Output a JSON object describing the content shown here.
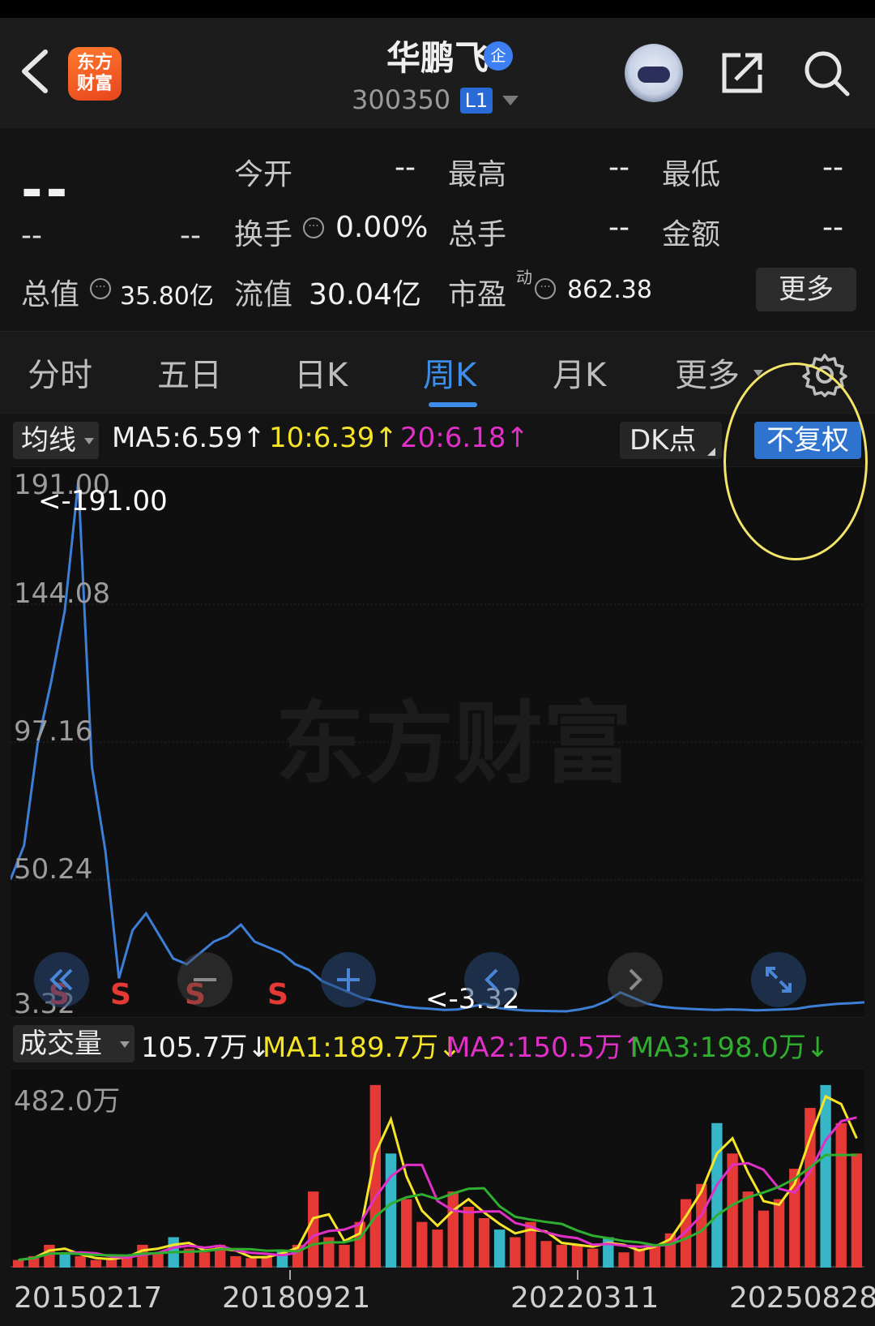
{
  "header": {
    "app_logo_text_line1": "东方",
    "app_logo_text_line2": "财富",
    "stock_name": "华鹏飞",
    "qi_badge": "企",
    "stock_code": "300350",
    "level_badge": "L1"
  },
  "quote": {
    "price": "--",
    "change": "--",
    "change_pct": "--",
    "open_label": "今开",
    "open_value": "--",
    "high_label": "最高",
    "high_value": "--",
    "low_label": "最低",
    "low_value": "--",
    "turnover_label": "换手",
    "turnover_value": "0.00%",
    "volume_label": "总手",
    "volume_value": "--",
    "amount_label": "金额",
    "amount_value": "--",
    "mktcap_label": "总值",
    "mktcap_value": "35.80亿",
    "float_label": "流值",
    "float_value": "30.04亿",
    "pe_label": "市盈",
    "pe_superscript": "动",
    "pe_value": "862.38",
    "more_button": "更多"
  },
  "tabs": [
    {
      "label": "分时",
      "active": false
    },
    {
      "label": "五日",
      "active": false
    },
    {
      "label": "日K",
      "active": false
    },
    {
      "label": "周K",
      "active": true
    },
    {
      "label": "月K",
      "active": false
    },
    {
      "label": "更多",
      "active": false
    }
  ],
  "ma_bar": {
    "indicator": "均线",
    "ma5": "MA5:6.59↑",
    "ma10": "10:6.39↑",
    "ma20": "20:6.18↑",
    "dk_button": "DK点",
    "adjust_button": "不复权"
  },
  "price_axis": {
    "max_label": "191.00",
    "tick2": "144.08",
    "tick3": "97.16",
    "tick4": "50.24",
    "min_label": "3.32",
    "max_marker": "<-191.00",
    "min_marker": "<-3.32",
    "watermark": "东方财富",
    "signal_marks": [
      "S",
      "S",
      "S",
      "S",
      "S"
    ]
  },
  "volume_bar": {
    "indicator": "成交量",
    "current": "105.7万↓",
    "ma1": "MA1:189.7万↓",
    "ma2": "MA2:150.5万↑",
    "ma3": "MA3:198.0万↓",
    "max_label": "482.0万"
  },
  "dates": [
    "20150217",
    "20180921",
    "20220311",
    "20250828"
  ],
  "colors": {
    "accent_blue": "#3d8eea",
    "price_line": "#3d7fd6",
    "up_red": "#e53935",
    "ma_yellow": "#f5e427",
    "ma_magenta": "#e030c8",
    "ma_green": "#2fae2f",
    "highlight": "#f3e56a"
  },
  "chart_data": [
    {
      "type": "line",
      "title": "",
      "xlabel": "",
      "ylabel": "",
      "ylim": [
        3.32,
        191.0
      ],
      "x_ticks": [
        "20150217",
        "20180921",
        "20220311",
        "20250828"
      ],
      "series": [
        {
          "values": [
            50,
            62,
            98,
            120,
            145,
            191,
            90,
            60,
            15,
            32,
            38,
            30,
            22,
            20,
            24,
            28,
            30,
            34,
            28,
            26,
            24,
            20,
            18,
            14,
            12,
            10,
            8,
            7,
            6,
            5,
            4.5,
            4.2,
            3.8,
            4,
            5,
            6,
            4.5,
            4,
            3.6,
            3.5,
            3.4,
            3.32,
            4,
            5,
            7,
            10,
            8,
            6,
            5,
            4.5,
            4.2,
            4,
            3.8,
            4,
            3.9,
            3.7,
            3.8,
            4,
            4.2,
            5,
            5.5,
            6,
            6.2,
            6.5
          ]
        }
      ]
    },
    {
      "type": "bar",
      "title": "",
      "ylim": [
        0,
        482.0
      ],
      "series": [
        {
          "values": [
            20,
            30,
            60,
            40,
            30,
            20,
            25,
            30,
            60,
            40,
            80,
            50,
            40,
            60,
            30,
            25,
            30,
            45,
            60,
            200,
            80,
            60,
            120,
            480,
            300,
            180,
            120,
            100,
            200,
            160,
            130,
            100,
            80,
            120,
            70,
            60,
            60,
            50,
            80,
            40,
            50,
            60,
            90,
            180,
            220,
            380,
            300,
            200,
            150,
            180,
            260,
            420,
            480,
            380,
            300
          ]
        }
      ]
    }
  ]
}
